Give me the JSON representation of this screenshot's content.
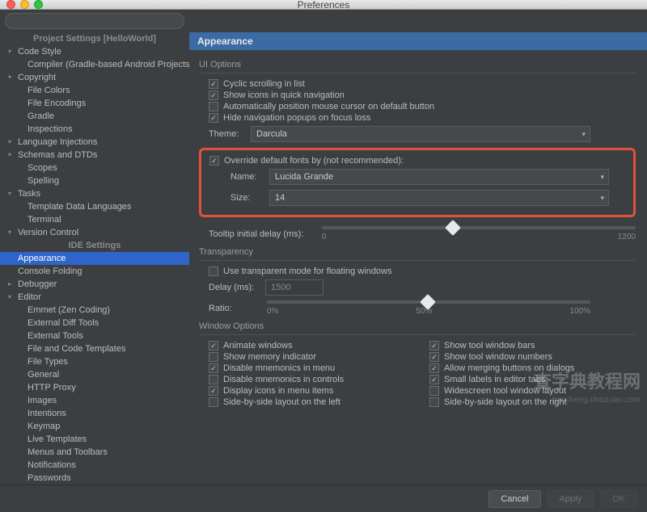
{
  "window": {
    "title": "Preferences"
  },
  "search": {
    "placeholder": ""
  },
  "sidebar": {
    "header1": "Project Settings [HelloWorld]",
    "items1": [
      {
        "label": "Code Style",
        "exp": true
      },
      {
        "label": "Compiler (Gradle-based Android Projects)",
        "lvl": 2
      },
      {
        "label": "Copyright",
        "exp": true
      },
      {
        "label": "File Colors",
        "lvl": 2
      },
      {
        "label": "File Encodings",
        "lvl": 2
      },
      {
        "label": "Gradle",
        "lvl": 2
      },
      {
        "label": "Inspections",
        "lvl": 2
      },
      {
        "label": "Language Injections",
        "exp": true
      },
      {
        "label": "Schemas and DTDs",
        "exp": true
      },
      {
        "label": "Scopes",
        "lvl": 2
      },
      {
        "label": "Spelling",
        "lvl": 2
      },
      {
        "label": "Tasks",
        "exp": true
      },
      {
        "label": "Template Data Languages",
        "lvl": 2
      },
      {
        "label": "Terminal",
        "lvl": 2
      },
      {
        "label": "Version Control",
        "exp": true
      }
    ],
    "header2": "IDE Settings",
    "items2": [
      {
        "label": "Appearance",
        "sel": true
      },
      {
        "label": "Console Folding"
      },
      {
        "label": "Debugger",
        "col": true
      },
      {
        "label": "Editor",
        "exp": true
      },
      {
        "label": "Emmet (Zen Coding)",
        "lvl": 2
      },
      {
        "label": "External Diff Tools",
        "lvl": 2
      },
      {
        "label": "External Tools",
        "lvl": 2
      },
      {
        "label": "File and Code Templates",
        "lvl": 2
      },
      {
        "label": "File Types",
        "lvl": 2
      },
      {
        "label": "General",
        "lvl": 2
      },
      {
        "label": "HTTP Proxy",
        "lvl": 2
      },
      {
        "label": "Images",
        "lvl": 2
      },
      {
        "label": "Intentions",
        "lvl": 2
      },
      {
        "label": "Keymap",
        "lvl": 2
      },
      {
        "label": "Live Templates",
        "lvl": 2
      },
      {
        "label": "Menus and Toolbars",
        "lvl": 2
      },
      {
        "label": "Notifications",
        "lvl": 2
      },
      {
        "label": "Passwords",
        "lvl": 2
      }
    ]
  },
  "content": {
    "title": "Appearance",
    "ui_options": {
      "title": "UI Options",
      "cyclic": "Cyclic scrolling in list",
      "icons_nav": "Show icons in quick navigation",
      "auto_mouse": "Automatically position mouse cursor on default button",
      "hide_popups": "Hide navigation popups on focus loss",
      "theme_label": "Theme:",
      "theme_value": "Darcula",
      "override": "Override default fonts by (not recommended):",
      "name_label": "Name:",
      "name_value": "Lucida Grande",
      "size_label": "Size:",
      "size_value": "14",
      "tooltip_label": "Tooltip initial delay (ms):",
      "tooltip_min": "0",
      "tooltip_max": "1200"
    },
    "transparency": {
      "title": "Transparency",
      "use": "Use transparent mode for floating windows",
      "delay_label": "Delay (ms):",
      "delay_value": "1500",
      "ratio_label": "Ratio:",
      "r0": "0%",
      "r50": "50%",
      "r100": "100%"
    },
    "window_options": {
      "title": "Window Options",
      "left": [
        {
          "label": "Animate windows",
          "on": true
        },
        {
          "label": "Show memory indicator",
          "on": false
        },
        {
          "label": "Disable mnemonics in menu",
          "on": true
        },
        {
          "label": "Disable mnemonics in controls",
          "on": false
        },
        {
          "label": "Display icons in menu items",
          "on": true
        },
        {
          "label": "Side-by-side layout on the left",
          "on": false
        }
      ],
      "right": [
        {
          "label": "Show tool window bars",
          "on": true
        },
        {
          "label": "Show tool window numbers",
          "on": true
        },
        {
          "label": "Allow merging buttons on dialogs",
          "on": true
        },
        {
          "label": "Small labels in editor tabs",
          "on": true
        },
        {
          "label": "Widescreen tool window layout",
          "on": false
        },
        {
          "label": "Side-by-side layout on the right",
          "on": false
        }
      ]
    }
  },
  "footer": {
    "cancel": "Cancel",
    "apply": "Apply",
    "ok": "OK"
  },
  "watermark": {
    "main": "查字典教程网",
    "sub": "jiaocheng.chaziدian.com"
  }
}
